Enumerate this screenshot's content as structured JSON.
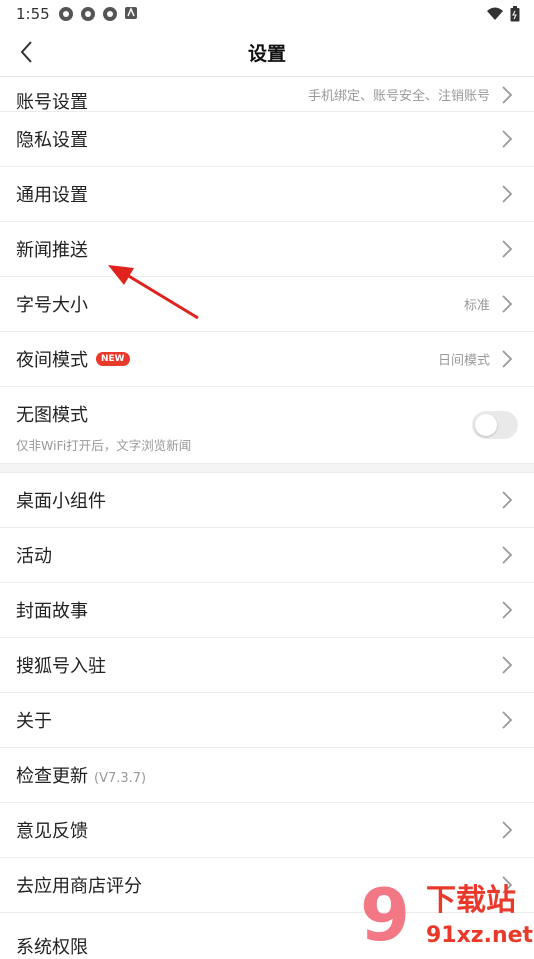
{
  "status": {
    "time": "1:55",
    "icons": [
      "app-icon",
      "app-icon",
      "app-icon",
      "notification-icon"
    ],
    "right_icons": [
      "wifi-icon",
      "battery-icon"
    ]
  },
  "nav": {
    "back_icon": "chevron-left-icon",
    "title": "设置"
  },
  "group1": [
    {
      "label": "账号设置",
      "right": "手机绑定、账号安全、注销账号"
    },
    {
      "label": "隐私设置",
      "right": ""
    },
    {
      "label": "通用设置",
      "right": ""
    },
    {
      "label": "新闻推送",
      "right": ""
    },
    {
      "label": "字号大小",
      "right": "标准"
    },
    {
      "label": "夜间模式",
      "badge": "NEW",
      "right": "日间模式"
    },
    {
      "label": "无图模式",
      "sub": "仅非WiFi打开后，文字浏览新闻",
      "toggle": false
    }
  ],
  "group2": [
    {
      "label": "桌面小组件"
    },
    {
      "label": "活动"
    },
    {
      "label": "封面故事"
    },
    {
      "label": "搜狐号入驻"
    },
    {
      "label": "关于"
    },
    {
      "label": "检查更新",
      "version": "(V7.3.7)"
    },
    {
      "label": "意见反馈"
    },
    {
      "label": "去应用商店评分"
    },
    {
      "label": "系统权限"
    }
  ],
  "watermark": {
    "text1": "下载站",
    "text2": "91xz.net",
    "logo": "9"
  },
  "colors": {
    "accent": "#e8392b",
    "arrow": "#e0231c"
  }
}
